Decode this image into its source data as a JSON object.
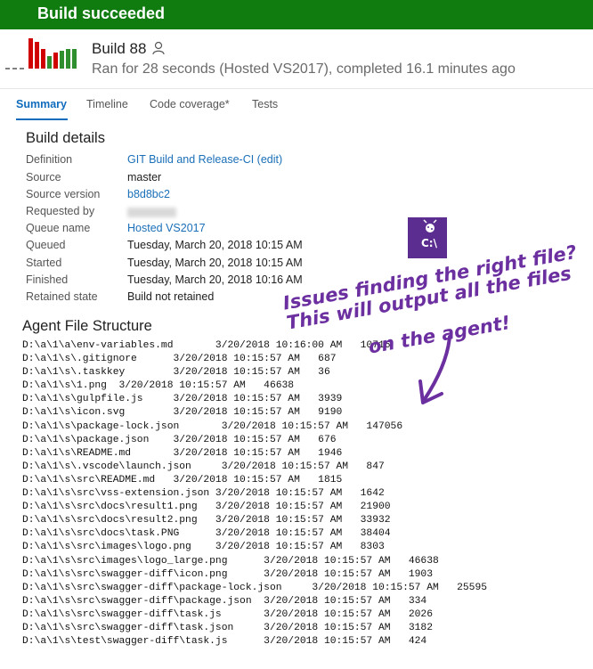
{
  "banner": {
    "status": "Build succeeded"
  },
  "build": {
    "title": "Build 88",
    "subtitle": "Ran for 28 seconds (Hosted VS2017), completed 16.1 minutes ago"
  },
  "tabs": [
    {
      "label": "Summary"
    },
    {
      "label": "Timeline"
    },
    {
      "label": "Code coverage*"
    },
    {
      "label": "Tests"
    }
  ],
  "build_details": {
    "title": "Build details",
    "rows": [
      {
        "label": "Definition",
        "value": "GIT Build and Release-CI (edit)"
      },
      {
        "label": "Source",
        "value": "master"
      },
      {
        "label": "Source version",
        "value": "b8d8bc2"
      },
      {
        "label": "Requested by",
        "value": ""
      },
      {
        "label": "Queue name",
        "value": "Hosted VS2017"
      },
      {
        "label": "Queued",
        "value": "Tuesday, March 20, 2018 10:15 AM"
      },
      {
        "label": "Started",
        "value": "Tuesday, March 20, 2018 10:15 AM"
      },
      {
        "label": "Finished",
        "value": "Tuesday, March 20, 2018 10:16 AM"
      },
      {
        "label": "Retained state",
        "value": "Build not retained"
      }
    ]
  },
  "agent_files": {
    "title": "Agent File Structure",
    "listing": "D:\\a\\1\\a\\env-variables.md       3/20/2018 10:16:00 AM   10716\nD:\\a\\1\\s\\.gitignore      3/20/2018 10:15:57 AM   687\nD:\\a\\1\\s\\.taskkey        3/20/2018 10:15:57 AM   36\nD:\\a\\1\\s\\1.png  3/20/2018 10:15:57 AM   46638\nD:\\a\\1\\s\\gulpfile.js     3/20/2018 10:15:57 AM   3939\nD:\\a\\1\\s\\icon.svg        3/20/2018 10:15:57 AM   9190\nD:\\a\\1\\s\\package-lock.json       3/20/2018 10:15:57 AM   147056\nD:\\a\\1\\s\\package.json    3/20/2018 10:15:57 AM   676\nD:\\a\\1\\s\\README.md       3/20/2018 10:15:57 AM   1946\nD:\\a\\1\\s\\.vscode\\launch.json     3/20/2018 10:15:57 AM   847\nD:\\a\\1\\s\\src\\README.md   3/20/2018 10:15:57 AM   1815\nD:\\a\\1\\s\\src\\vss-extension.json 3/20/2018 10:15:57 AM   1642\nD:\\a\\1\\s\\src\\docs\\result1.png   3/20/2018 10:15:57 AM   21900\nD:\\a\\1\\s\\src\\docs\\result2.png   3/20/2018 10:15:57 AM   33932\nD:\\a\\1\\s\\src\\docs\\task.PNG      3/20/2018 10:15:57 AM   38404\nD:\\a\\1\\s\\src\\images\\logo.png    3/20/2018 10:15:57 AM   8303\nD:\\a\\1\\s\\src\\images\\logo_large.png      3/20/2018 10:15:57 AM   46638\nD:\\a\\1\\s\\src\\swagger-diff\\icon.png      3/20/2018 10:15:57 AM   1903\nD:\\a\\1\\s\\src\\swagger-diff\\package-lock.json     3/20/2018 10:15:57 AM   25595\nD:\\a\\1\\s\\src\\swagger-diff\\package.json  3/20/2018 10:15:57 AM   334\nD:\\a\\1\\s\\src\\swagger-diff\\task.js       3/20/2018 10:15:57 AM   2026\nD:\\a\\1\\s\\src\\swagger-diff\\task.json     3/20/2018 10:15:57 AM   3182\nD:\\a\\1\\s\\test\\swagger-diff\\task.js      3/20/2018 10:15:57 AM   424"
  },
  "annotation": {
    "line1": "Issues finding the right file?",
    "line2": "This will output all the files",
    "line3": "on the agent!",
    "logo_text": "C:\\",
    "color": "#6b2fa0"
  },
  "icons": {
    "build_history": "bar-chart-icon",
    "requested_by": "person-icon",
    "logo": "bug-logo-icon",
    "arrow": "hand-drawn-arrow-icon"
  },
  "colors": {
    "success": "#107c10",
    "failed_bar": "#d00000",
    "success_bar": "#2f8f2f",
    "link": "#1a6fb8"
  }
}
